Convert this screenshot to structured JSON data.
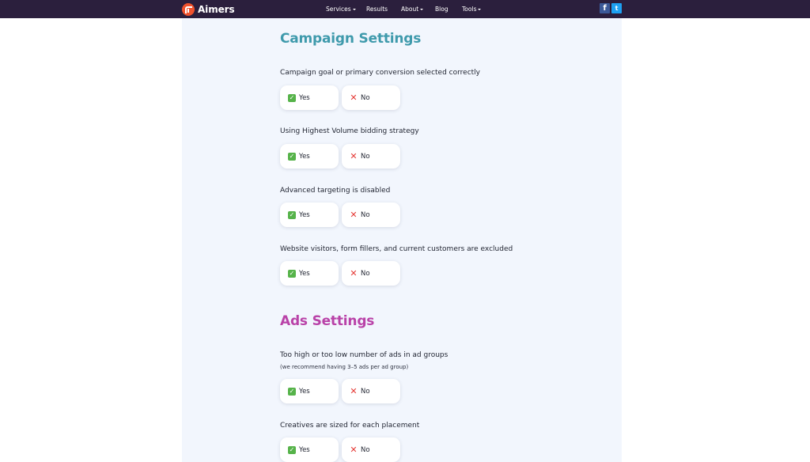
{
  "brand": {
    "name": "Aimers"
  },
  "nav": {
    "services": "Services",
    "results": "Results",
    "about": "About",
    "blog": "Blog",
    "tools": "Tools"
  },
  "social": {
    "facebook": "f",
    "twitter": "t"
  },
  "icons": {
    "yes": "✓",
    "no": "✕",
    "yes_color": "#56b34a",
    "no_color": "#e53935"
  },
  "sections": [
    {
      "title": "Campaign Settings",
      "color": "#3f9aac",
      "questions": [
        {
          "text": "Campaign goal or primary conversion selected correctly",
          "yes": "Yes",
          "no": "No"
        },
        {
          "text": "Using Highest Volume bidding strategy",
          "yes": "Yes",
          "no": "No"
        },
        {
          "text": "Advanced targeting is disabled",
          "yes": "Yes",
          "no": "No"
        },
        {
          "text": "Website visitors, form fillers, and current customers are excluded",
          "yes": "Yes",
          "no": "No"
        }
      ]
    },
    {
      "title": "Ads Settings",
      "color": "#b942a8",
      "questions": [
        {
          "text": "Too high or too low number of ads in ad groups",
          "subtext": "(we recommend having 3–5 ads per ad group)",
          "yes": "Yes",
          "no": "No"
        },
        {
          "text": "Creatives are sized for each placement",
          "yes": "Yes",
          "no": "No"
        }
      ]
    }
  ]
}
